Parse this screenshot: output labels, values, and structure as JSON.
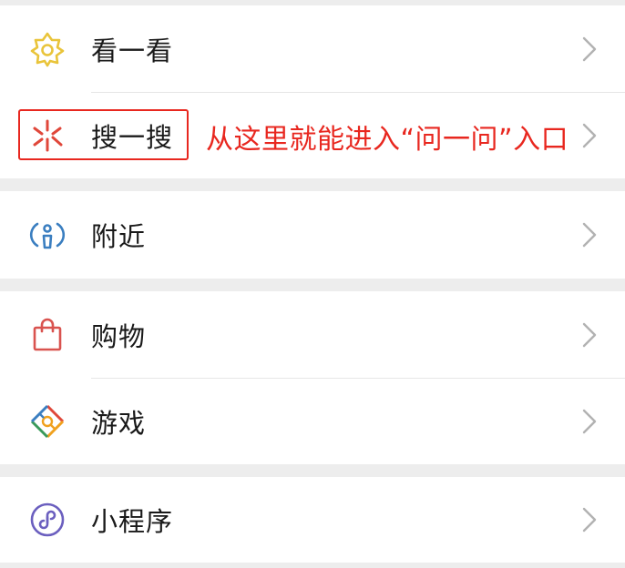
{
  "menu": {
    "group1": {
      "items": [
        {
          "label": "看一看",
          "icon": "look-icon",
          "color": "#e9c43a"
        },
        {
          "label": "搜一搜",
          "icon": "search-spark-icon",
          "color": "#e0473a"
        }
      ]
    },
    "group2": {
      "items": [
        {
          "label": "附近",
          "icon": "nearby-person-icon",
          "color": "#3a7ec0"
        }
      ]
    },
    "group3": {
      "items": [
        {
          "label": "购物",
          "icon": "shopping-bag-icon",
          "color": "#d9534f"
        },
        {
          "label": "游戏",
          "icon": "game-diamond-icon",
          "color": "#f0a11e"
        }
      ]
    },
    "group4": {
      "items": [
        {
          "label": "小程序",
          "icon": "mini-program-icon",
          "color": "#6b5fbf"
        }
      ]
    }
  },
  "annotation": {
    "text": "从这里就能进入“问一问”入口",
    "color": "#e8271f"
  }
}
